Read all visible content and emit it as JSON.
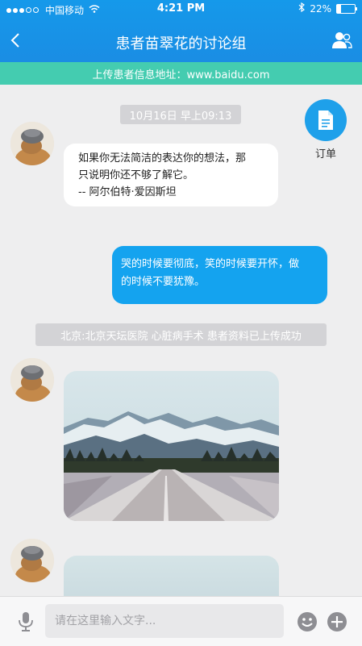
{
  "status_bar": {
    "carrier": "中国移动",
    "time": "4:21 PM",
    "battery": "22%",
    "battery_level": 0.22
  },
  "header": {
    "title": "患者苗翠花的讨论组",
    "back_icon": "chevron-left-icon",
    "contacts_icon": "group-members-icon"
  },
  "banner": {
    "text": "上传患者信息地址：www.baidu.com"
  },
  "order": {
    "label": "订单",
    "icon": "document-icon"
  },
  "messages": {
    "timestamp": "10月16日 早上09:13",
    "incoming_text": {
      "line1": "如果你无法简洁的表达你的想法，那",
      "line2": "只说明你还不够了解它。",
      "line3": "-- 阿尔伯特·爱因斯坦"
    },
    "outgoing_text": {
      "line1": "哭的时候要彻底，笑的时候要开怀，做",
      "line2": "的时候不要犹豫。"
    },
    "notice": "北京:北京天坛医院 心脏病手术 患者资料已上传成功"
  },
  "input_bar": {
    "placeholder": "请在这里输入文字...",
    "value": "",
    "mic_icon": "microphone-icon",
    "emoji_icon": "emoji-icon",
    "plus_icon": "plus-circle-icon"
  },
  "colors": {
    "header": "#1a8de4",
    "banner": "#44ccb0",
    "outgoing_bubble": "#14a3ef",
    "background": "#eeeeef"
  }
}
